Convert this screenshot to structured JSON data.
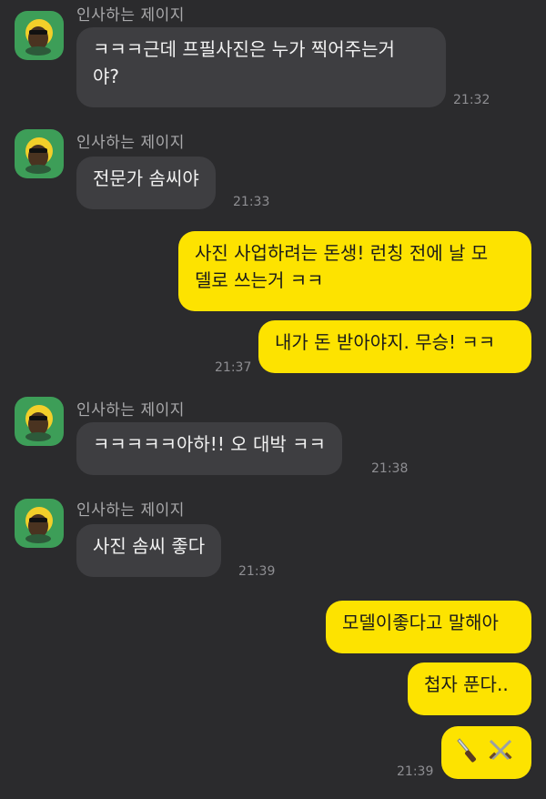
{
  "sender_name": "인사하는 제이지",
  "messages": [
    {
      "dir": "in",
      "line1": "ㅋㅋㅋ근데 프필사진은 누가 찍어주는거",
      "line2": "야?",
      "time": "21:32"
    },
    {
      "dir": "in",
      "text": "전문가 솜씨야",
      "time": "21:33"
    },
    {
      "dir": "out",
      "line1": "사진 사업하려는 돈생! 런칭 전에 날 모",
      "line2": "델로 쓰는거 ㅋㅋ"
    },
    {
      "dir": "out",
      "text": "내가 돈 받아야지. 무승! ㅋㅋ",
      "time": "21:37"
    },
    {
      "dir": "in",
      "text": "ㅋㅋㅋㅋㅋ아하!! 오 대박 ㅋㅋ",
      "time": "21:38"
    },
    {
      "dir": "in",
      "text": "사진 솜씨 좋다",
      "time": "21:39"
    },
    {
      "dir": "out",
      "text": "모델이좋다고 말해아"
    },
    {
      "dir": "out",
      "text": "첩자 푼다.."
    },
    {
      "dir": "out",
      "emoji": "knife-and-swords",
      "time": "21:39"
    }
  ],
  "colors": {
    "background": "#2b2b2d",
    "incoming_bubble": "#3e3e41",
    "outgoing_bubble": "#fde300",
    "avatar_bg": "#3d9e58"
  }
}
